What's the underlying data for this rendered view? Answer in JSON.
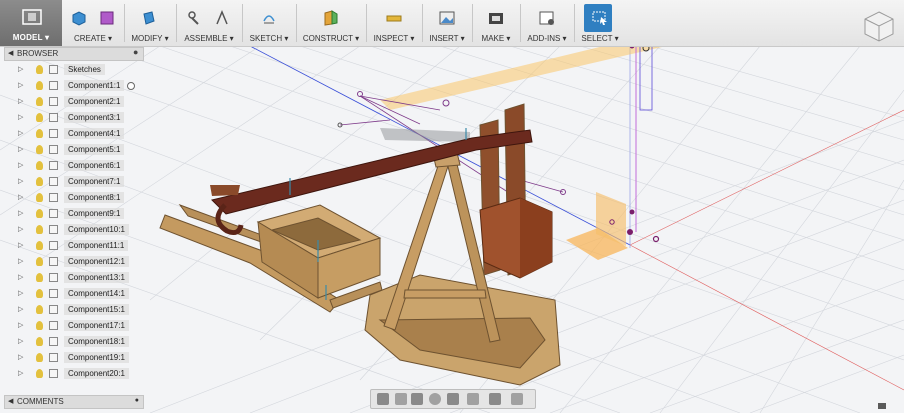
{
  "toolbar": {
    "workspace_label": "MODEL ▾",
    "groups": [
      {
        "label": "CREATE ▾",
        "icon": "box-icon"
      },
      {
        "label": "MODIFY ▾",
        "icon": "push-pull-icon"
      },
      {
        "label": "ASSEMBLE ▾",
        "icon": "joint-icon"
      },
      {
        "label": "SKETCH ▾",
        "icon": "sketch-icon"
      },
      {
        "label": "CONSTRUCT ▾",
        "icon": "plane-icon"
      },
      {
        "label": "INSPECT ▾",
        "icon": "measure-icon"
      },
      {
        "label": "INSERT ▾",
        "icon": "image-icon"
      },
      {
        "label": "MAKE ▾",
        "icon": "printer-icon"
      },
      {
        "label": "ADD-INS ▾",
        "icon": "scripts-icon"
      },
      {
        "label": "SELECT ▾",
        "icon": "select-icon"
      }
    ]
  },
  "browser": {
    "title": "BROWSER",
    "items": [
      {
        "label": "Sketches"
      },
      {
        "label": "Component1:1"
      },
      {
        "label": "Component2:1"
      },
      {
        "label": "Component3:1"
      },
      {
        "label": "Component4:1"
      },
      {
        "label": "Component5:1"
      },
      {
        "label": "Component6:1"
      },
      {
        "label": "Component7:1"
      },
      {
        "label": "Component8:1"
      },
      {
        "label": "Component9:1"
      },
      {
        "label": "Component10:1"
      },
      {
        "label": "Component11:1"
      },
      {
        "label": "Component12:1"
      },
      {
        "label": "Component13:1"
      },
      {
        "label": "Component14:1"
      },
      {
        "label": "Component15:1"
      },
      {
        "label": "Component17:1"
      },
      {
        "label": "Component18:1"
      },
      {
        "label": "Component19:1"
      },
      {
        "label": "Component20:1"
      }
    ]
  },
  "comments": {
    "title": "COMMENTS"
  },
  "navbar": {
    "icons": [
      "orbit-icon",
      "look-at-icon",
      "pan-icon",
      "zoom-icon",
      "fit-icon",
      "display-settings-icon",
      "grid-settings-icon",
      "viewports-icon"
    ]
  },
  "colors": {
    "accent": "#2f7fc1",
    "wood": "#b48a55",
    "arm": "#6b2a1e",
    "plane": "#f5c060"
  }
}
